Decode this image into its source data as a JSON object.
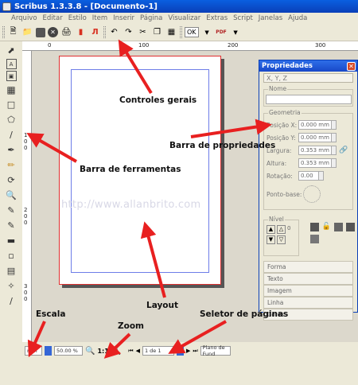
{
  "window": {
    "title": "Scribus 1.3.3.8 - [Documento-1]"
  },
  "menu": [
    "Arquivo",
    "Editar",
    "Estilo",
    "Item",
    "Inserir",
    "Página",
    "Visualizar",
    "Extras",
    "Script",
    "Janelas",
    "Ajuda"
  ],
  "toolbar": {
    "ok_label": "OK",
    "pdf_label": "PDF"
  },
  "rulers": {
    "h": [
      "0",
      "100",
      "200",
      "300"
    ],
    "v": [
      "1",
      "0",
      "0",
      "2",
      "0",
      "0",
      "3",
      "0",
      "0"
    ]
  },
  "watermark": "http://www.allanbrito.com",
  "properties": {
    "title": "Propriedades",
    "tab_xyz": "X, Y, Z",
    "name_label": "Nome",
    "geometry_label": "Geometria",
    "pos_x": {
      "label": "Posição X:",
      "value": "0.000 mm"
    },
    "pos_y": {
      "label": "Posição Y:",
      "value": "0.000 mm"
    },
    "width": {
      "label": "Largura:",
      "value": "0.353 mm"
    },
    "height": {
      "label": "Altura:",
      "value": "0.353 mm"
    },
    "rotation": {
      "label": "Rotação:",
      "value": "0.00"
    },
    "base_point_label": "Ponto-base:",
    "level_label": "Nível",
    "level_value": "0",
    "sections": [
      "Forma",
      "Texto",
      "Imagem",
      "Linha",
      "Cores"
    ]
  },
  "statusbar": {
    "unit": "mm",
    "zoom": "50.00 %",
    "zoom_reset": "1:1",
    "page": "1 de 1",
    "layer": "Plano de Fund"
  },
  "annotations": {
    "controles": "Controles gerais",
    "ferramentas": "Barra de ferramentas",
    "propriedades": "Barra de propriedades",
    "layout": "Layout",
    "escala": "Escala",
    "zoom": "Zoom",
    "seletor": "Seletor de páginas"
  },
  "colors": {
    "arrow": "#e82020",
    "page_border": "#e03030",
    "titlebar": "#0a4fd0"
  }
}
